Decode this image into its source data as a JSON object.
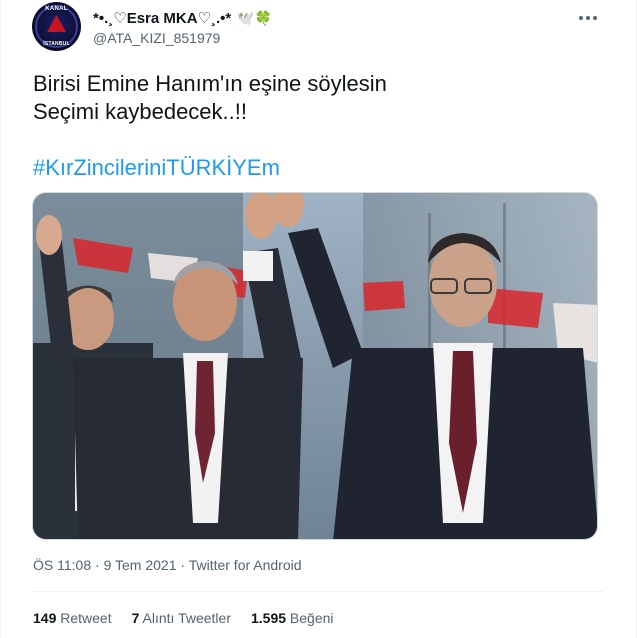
{
  "tweet": {
    "avatar": {
      "text_top": "KANAL",
      "text_bottom": "İSTANBUL"
    },
    "display_name": "*•.¸♡Esra MKA♡¸.•*",
    "name_emojis": "🕊️🍀",
    "handle": "@ATA_KIZI_851979",
    "text_line1": "Birisi Emine Hanım'ın eşine söylesin",
    "text_line2": "Seçimi kaybedecek..!!",
    "hashtag": "#KırZincileriniTÜRKİYEm",
    "time": "ÖS 11:08",
    "date": "9 Tem 2021",
    "source": "Twitter for Android",
    "stats": {
      "retweets_count": "149",
      "retweets_label": "Retweet",
      "quotes_count": "7",
      "quotes_label": "Alıntı Tweetler",
      "likes_count": "1.595",
      "likes_label": "Beğeni"
    }
  },
  "colors": {
    "link": "#1d9bf0",
    "text": "#0f1419",
    "secondary": "#536471",
    "border": "#eff3f4"
  },
  "icons": [
    "more-options-icon"
  ]
}
